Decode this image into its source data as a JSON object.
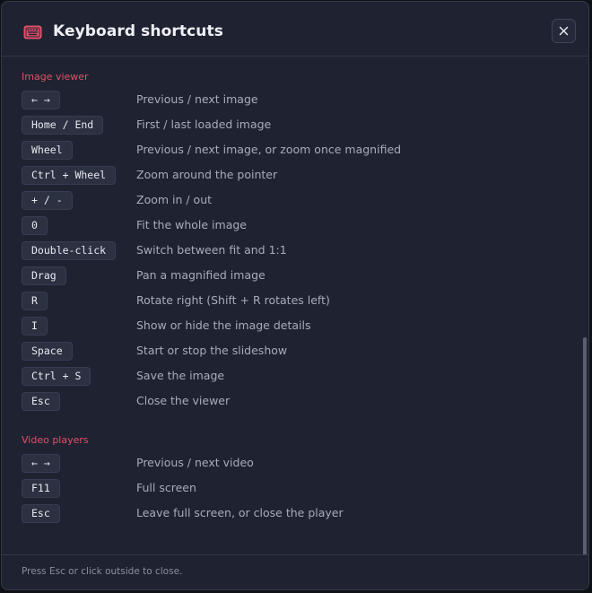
{
  "dialog": {
    "title": "Keyboard shortcuts",
    "header_icon": "keyboard-icon",
    "close_icon": "close-icon",
    "accent_color": "#e0506a",
    "footer_text": "Press Esc or click outside to close."
  },
  "sections": [
    {
      "title": "Image viewer",
      "shortcuts": [
        {
          "key": "← →",
          "desc": "Previous / next image"
        },
        {
          "key": "Home / End",
          "desc": "First / last loaded image"
        },
        {
          "key": "Wheel",
          "desc": "Previous / next image, or zoom once magnified"
        },
        {
          "key": "Ctrl + Wheel",
          "desc": "Zoom around the pointer"
        },
        {
          "key": "+ / -",
          "desc": "Zoom in / out"
        },
        {
          "key": "0",
          "desc": "Fit the whole image"
        },
        {
          "key": "Double-click",
          "desc": "Switch between fit and 1:1"
        },
        {
          "key": "Drag",
          "desc": "Pan a magnified image"
        },
        {
          "key": "R",
          "desc": "Rotate right (Shift + R rotates left)"
        },
        {
          "key": "I",
          "desc": "Show or hide the image details"
        },
        {
          "key": "Space",
          "desc": "Start or stop the slideshow"
        },
        {
          "key": "Ctrl + S",
          "desc": "Save the image"
        },
        {
          "key": "Esc",
          "desc": "Close the viewer"
        }
      ]
    },
    {
      "title": "Video players",
      "shortcuts": [
        {
          "key": "← →",
          "desc": "Previous / next video"
        },
        {
          "key": "F11",
          "desc": "Full screen"
        },
        {
          "key": "Esc",
          "desc": "Leave full screen, or close the player"
        }
      ]
    }
  ]
}
